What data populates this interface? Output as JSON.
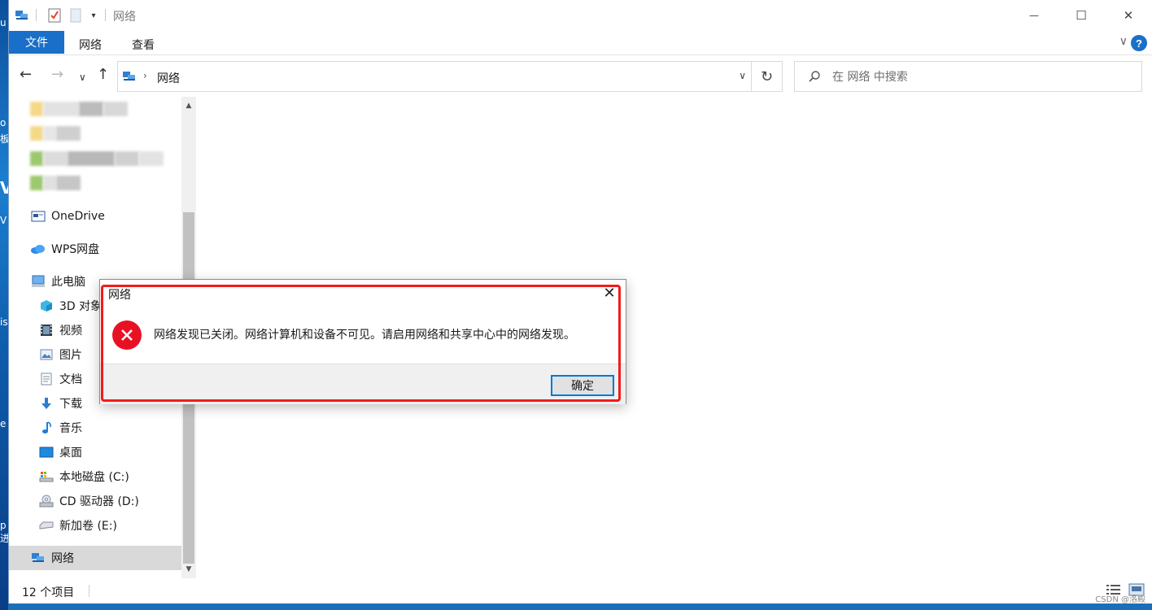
{
  "window": {
    "title": "网络",
    "caption": {
      "minimize": "—",
      "maximize": "☐",
      "close": "✕"
    }
  },
  "ribbon": {
    "tabs": [
      "文件",
      "网络",
      "查看"
    ],
    "collapse_glyph": "∨",
    "help_glyph": "?"
  },
  "nav": {
    "back_glyph": "←",
    "forward_glyph": "→",
    "recent_glyph": "∨",
    "up_glyph": "↑",
    "address_crumb": "网络",
    "refresh_glyph": "↻",
    "search_placeholder": "在 网络 中搜索"
  },
  "navpane": {
    "items": [
      {
        "label": "OneDrive",
        "icon": "onedrive-icon"
      },
      {
        "label": "WPS网盘",
        "icon": "cloud-icon"
      },
      {
        "label": "此电脑",
        "icon": "computer-icon"
      },
      {
        "label": "3D 对象",
        "icon": "3d-objects-icon"
      },
      {
        "label": "视频",
        "icon": "video-icon"
      },
      {
        "label": "图片",
        "icon": "pictures-icon"
      },
      {
        "label": "文档",
        "icon": "documents-icon"
      },
      {
        "label": "下载",
        "icon": "download-icon"
      },
      {
        "label": "音乐",
        "icon": "music-icon"
      },
      {
        "label": "桌面",
        "icon": "desktop-icon"
      },
      {
        "label": "本地磁盘 (C:)",
        "icon": "local-disk-icon"
      },
      {
        "label": "CD 驱动器 (D:)",
        "icon": "cd-drive-icon"
      },
      {
        "label": "新加卷 (E:)",
        "icon": "volume-icon"
      },
      {
        "label": "网络",
        "icon": "network-icon"
      }
    ]
  },
  "status": {
    "item_count": "12 个项目",
    "watermark": "CSDN @洛殿"
  },
  "dialog": {
    "title": "网络",
    "close_glyph": "✕",
    "message": "网络发现已关闭。网络计算机和设备不可见。请启用网络和共享中心中的网络发现。",
    "ok_label": "确定"
  },
  "colors": {
    "accent": "#1a70c8",
    "error": "#e81123",
    "highlight_outline": "#f21b1b"
  }
}
